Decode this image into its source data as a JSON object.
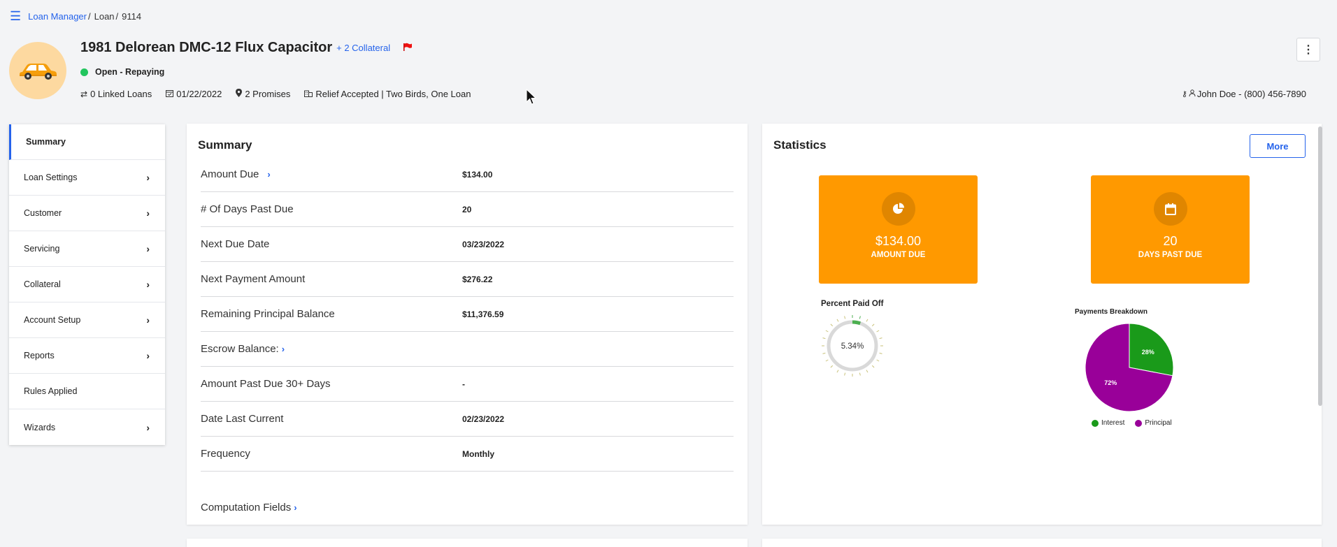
{
  "breadcrumb": {
    "items": [
      "Loan Manager",
      "Loan",
      "9114"
    ],
    "separator": "/"
  },
  "header": {
    "title": "1981 Delorean DMC-12 Flux Capacitor",
    "collateral_link": "+ 2 Collateral",
    "status": "Open - Repaying",
    "status_color": "#22c55e",
    "linked_loans": "0 Linked Loans",
    "date": "01/22/2022",
    "promises": "2 Promises",
    "relief": "Relief Accepted | Two Birds, One Loan",
    "contact": "John Doe - (800) 456-7890"
  },
  "sidebar": {
    "items": [
      {
        "label": "Summary",
        "active": true,
        "chevron": false
      },
      {
        "label": "Loan Settings",
        "chevron": true
      },
      {
        "label": "Customer",
        "chevron": true
      },
      {
        "label": "Servicing",
        "chevron": true
      },
      {
        "label": "Collateral",
        "chevron": true
      },
      {
        "label": "Account Setup",
        "chevron": true
      },
      {
        "label": "Reports",
        "chevron": true
      },
      {
        "label": "Rules Applied",
        "chevron": false
      },
      {
        "label": "Wizards",
        "chevron": true
      }
    ]
  },
  "summary": {
    "title": "Summary",
    "rows": [
      {
        "label": "Amount Due",
        "value": "$134.00"
      },
      {
        "label": "# Of Days Past Due",
        "value": "20"
      },
      {
        "label": "Next Due Date",
        "value": "03/23/2022"
      },
      {
        "label": "Next Payment Amount",
        "value": "$276.22"
      },
      {
        "label": "Remaining Principal Balance",
        "value": "$11,376.59"
      },
      {
        "label": "Escrow Balance:",
        "value": ""
      },
      {
        "label": "Amount Past Due 30+ Days",
        "value": "-"
      },
      {
        "label": "Date Last Current",
        "value": "02/23/2022"
      },
      {
        "label": "Frequency",
        "value": "Monthly"
      }
    ],
    "computation_link": "Computation Fields"
  },
  "statistics": {
    "title": "Statistics",
    "more_label": "More",
    "tiles": [
      {
        "value": "$134.00",
        "label": "AMOUNT DUE",
        "icon": "pie-chart-icon"
      },
      {
        "value": "20",
        "label": "DAYS PAST DUE",
        "icon": "calendar-icon"
      }
    ],
    "tile_color": "#ff9900",
    "percent_paid_title": "Percent Paid Off",
    "percent_paid_value": "5.34%",
    "percent_paid": 5.34,
    "breakdown_title": "Payments Breakdown"
  },
  "chart_data": {
    "type": "pie",
    "title": "Payments Breakdown",
    "categories": [
      "Interest",
      "Principal"
    ],
    "values": [
      28,
      72
    ],
    "labels": [
      "28%",
      "72%"
    ],
    "colors": [
      "#1a9a1a",
      "#990099"
    ],
    "legend": "bottom"
  }
}
